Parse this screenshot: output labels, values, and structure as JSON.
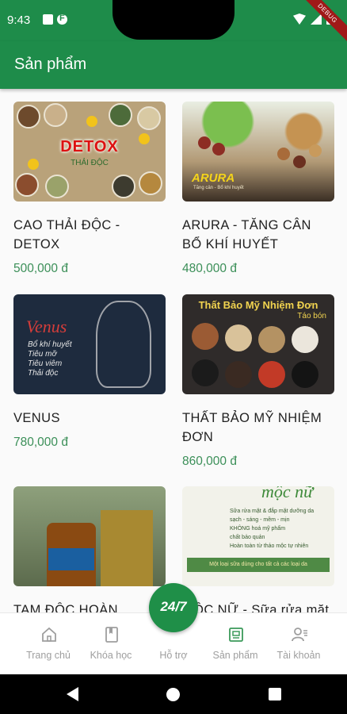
{
  "status_bar": {
    "time": "9:43",
    "debug_label": "DEBUG"
  },
  "app_bar": {
    "title": "Sản phẩm"
  },
  "products": [
    {
      "name": "CAO THẢI ĐỘC -\nDETOX",
      "price": "500,000 đ",
      "image_text": "DETOX",
      "image_subtext": "THẢI ĐỘC"
    },
    {
      "name": "ARURA - TĂNG CÂN\nBỔ KHÍ HUYẾT",
      "price": "480,000 đ",
      "image_text": "ARURA",
      "image_subtext": "Tăng cân - Bổ khí huyết"
    },
    {
      "name": "VENUS",
      "price": "780,000 đ",
      "image_text": "Venus",
      "image_subtext": "Bổ khí huyết\nTiêu mỡ\nTiêu viêm\nThải độc"
    },
    {
      "name": "THẤT BẢO MỸ NHIỆM\nĐƠN",
      "price": "860,000 đ",
      "image_text": "Thất Bảo Mỹ Nhiệm Đơn",
      "image_subtext": "Táo bón"
    },
    {
      "name": "TAM ĐỘC HOÀN",
      "price": "",
      "image_text": "",
      "image_subtext": ""
    },
    {
      "name": "MỘC NỮ - Sữa rửa mặt",
      "price": "",
      "image_text": "mộc nữ",
      "image_subtext": "Sữa rửa mặt & đắp mặt dưỡng da\nsạch - sáng - mềm - mịn\nKHÔNG hoá mỹ phẩm\nchất bảo quản\nHoàn toàn từ thảo mộc tự nhiên",
      "image_bar": "Một loại sữa dùng cho tất cả các loại da"
    }
  ],
  "fab": {
    "label": "24/7"
  },
  "bottom_nav": [
    {
      "label": "Trang chủ",
      "icon": "home-icon",
      "active": false
    },
    {
      "label": "Khóa học",
      "icon": "book-icon",
      "active": false
    },
    {
      "label": "Hỗ trợ",
      "icon": "support-icon",
      "active": false
    },
    {
      "label": "Sản phẩm",
      "icon": "product-icon",
      "active": true
    },
    {
      "label": "Tài khoản",
      "icon": "account-icon",
      "active": false
    }
  ],
  "colors": {
    "primary": "#1e8c4a",
    "price": "#3b8f58",
    "active_nav": "#3b9a5a",
    "inactive_nav": "#9e9e9e"
  }
}
